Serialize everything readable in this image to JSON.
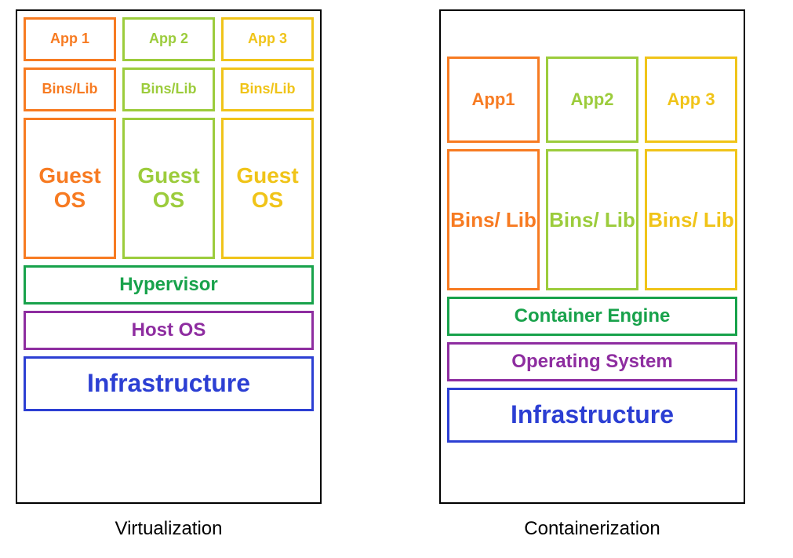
{
  "colors": {
    "orange": "#f77b22",
    "lime": "#9ccc3c",
    "gold": "#f0c419",
    "green": "#18a24b",
    "purple": "#8e2da0",
    "blue": "#2c3fd3"
  },
  "left": {
    "caption": "Virtualization",
    "columns": [
      {
        "app": "App 1",
        "bins": "Bins/Lib",
        "guest": "Guest OS",
        "color": "orange"
      },
      {
        "app": "App 2",
        "bins": "Bins/Lib",
        "guest": "Guest OS",
        "color": "lime"
      },
      {
        "app": "App 3",
        "bins": "Bins/Lib",
        "guest": "Guest OS",
        "color": "gold"
      }
    ],
    "hypervisor": "Hypervisor",
    "host_os": "Host OS",
    "infrastructure": "Infrastructure"
  },
  "right": {
    "caption": "Containerization",
    "columns": [
      {
        "app": "App1",
        "bins": "Bins/ Lib",
        "color": "orange"
      },
      {
        "app": "App2",
        "bins": "Bins/ Lib",
        "color": "lime"
      },
      {
        "app": "App 3",
        "bins": "Bins/ Lib",
        "color": "gold"
      }
    ],
    "container_engine": "Container Engine",
    "operating_system": "Operating System",
    "infrastructure": "Infrastructure"
  }
}
